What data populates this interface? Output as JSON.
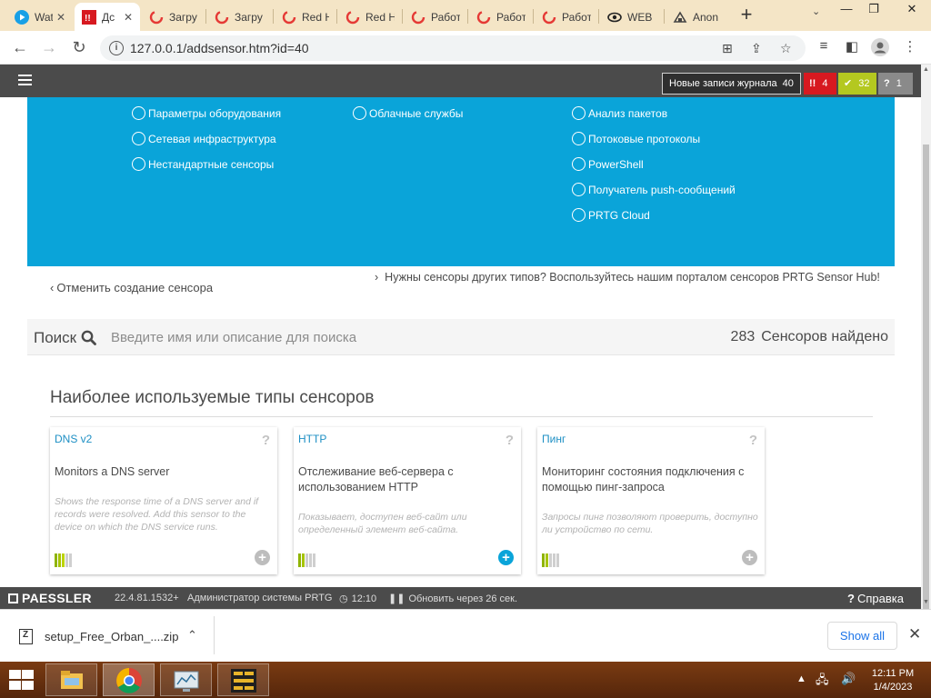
{
  "browser": {
    "tabs": [
      {
        "title": "Watch",
        "icon": "youtube-icon",
        "active": false
      },
      {
        "title": "Дс",
        "icon": "prtg-icon",
        "active": true
      },
      {
        "title": "Загру",
        "icon": "loading-tab-icon",
        "active": false
      },
      {
        "title": "Загру",
        "icon": "loading-tab-icon",
        "active": false
      },
      {
        "title": "Red H",
        "icon": "loading-tab-icon",
        "active": false
      },
      {
        "title": "Red H",
        "icon": "loading-tab-icon",
        "active": false
      },
      {
        "title": "Работ",
        "icon": "loading-tab-icon",
        "active": false
      },
      {
        "title": "Работ",
        "icon": "loading-tab-icon",
        "active": false
      },
      {
        "title": "Работ",
        "icon": "loading-tab-icon",
        "active": false
      },
      {
        "title": "WEB",
        "icon": "eye-icon",
        "active": false
      },
      {
        "title": "Anon",
        "icon": "anon-icon",
        "active": false
      }
    ],
    "new_tab": "+",
    "url": "127.0.0.1/addsensor.htm?id=40"
  },
  "prtg": {
    "header": {
      "log_label": "Новые записи журнала",
      "log_count": "40",
      "alarm_count": "4",
      "ok_count": "32",
      "unknown_count": "1"
    },
    "options": {
      "col1": [
        "Параметры оборудования",
        "Сетевая инфраструктура",
        "Нестандартные сенсоры"
      ],
      "col2": [
        "Облачные службы"
      ],
      "col3": [
        "Анализ пакетов",
        "Потоковые протоколы",
        "PowerShell",
        "Получатель push-сообщений",
        "PRTG Cloud"
      ]
    },
    "cancel_label": "Отменить создание сенсора",
    "hub_label": "Нужны сенсоры других типов? Воспользуйтесь нашим порталом сенсоров PRTG Sensor Hub!",
    "search": {
      "label": "Поиск",
      "placeholder": "Введите имя или описание для поиска",
      "count": "283",
      "count_label": "Сенсоров найдено"
    },
    "section_title": "Наиболее используемые типы сенсоров",
    "cards": [
      {
        "title": "DNS v2",
        "description": "Monitors a DNS server",
        "subdescription": "Shows the response time of a DNS server and if records were resolved. Add this sensor to the device on which the DNS service runs.",
        "usage_level": 0.6,
        "add_highlighted": false
      },
      {
        "title": "HTTP",
        "description": "Отслеживание веб-сервера с использованием HTTP",
        "subdescription": "Показывает, доступен веб-сайт или определенный элемент веб-сайта.",
        "usage_level": 0.4,
        "add_highlighted": true
      },
      {
        "title": "Пинг",
        "description": "Мониторинг состояния подключения с помощью пинг-запроса",
        "subdescription": "Запросы пинг позволяют проверить, доступно ли устройство по сети.",
        "usage_level": 0.4,
        "add_highlighted": false
      }
    ],
    "footer": {
      "logo": "PAESSLER",
      "version": "22.4.81.1532+",
      "user": "Администратор системы PRTG",
      "time": "12:10",
      "refresh": "Обновить через 26 сек.",
      "help": "Справка"
    }
  },
  "downloads": {
    "file_name": "setup_Free_Orban_....zip",
    "show_all": "Show all"
  },
  "taskbar": {
    "time": "12:11 PM",
    "date": "1/4/2023"
  },
  "colors": {
    "panel_blue": "#0aa4d9",
    "link_blue": "#1d8fc4",
    "alarm_red": "#d71920",
    "ok_green": "#b4c820",
    "header_gray": "#4b4b4b"
  }
}
